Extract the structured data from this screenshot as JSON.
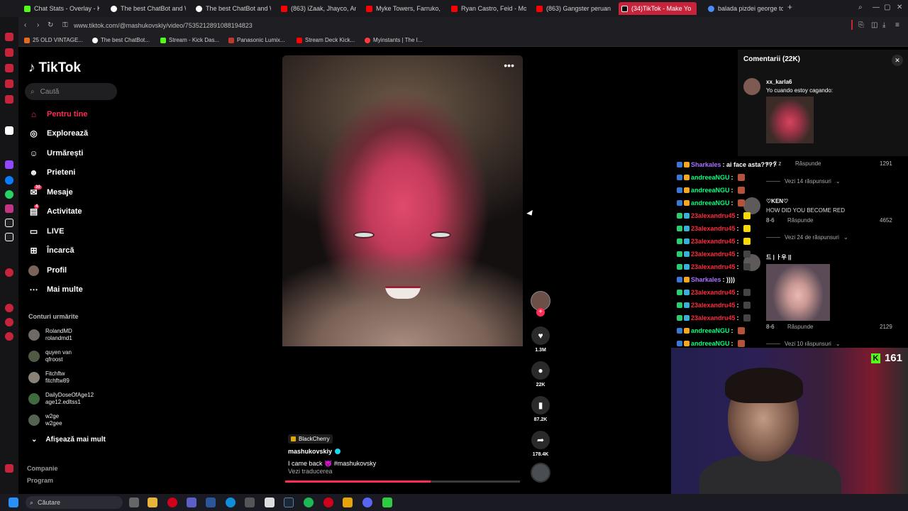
{
  "browser": {
    "tabs": [
      {
        "label": "Chat Stats - Overlay - Kic",
        "color": "#53fc18"
      },
      {
        "label": "The best ChatBot and Wi",
        "color": "#ffffff"
      },
      {
        "label": "The best ChatBot and Wi",
        "color": "#ffffff"
      },
      {
        "label": "(863) iZaak, Jhayco, Anu",
        "color": "#ff0000"
      },
      {
        "label": "Myke Towers, Farruko, A",
        "color": "#ff0000"
      },
      {
        "label": "Ryan Castro, Feid - Mona",
        "color": "#ff0000"
      },
      {
        "label": "(863) Gangster peruan şi",
        "color": "#ff0000"
      },
      {
        "label": "(34)TikTok - Make Yo",
        "color": "#ffffff"
      },
      {
        "label": "balada pizdei george topi",
        "color": "#4a8df8"
      }
    ],
    "new_tab": "+",
    "url": "www.tiktok.com/@mashukovskiy/video/7535212891088194823",
    "bookmarks": [
      {
        "label": "25 OLD VINTAGE...",
        "color": "#e36b1b"
      },
      {
        "label": "The best ChatBot...",
        "color": "#ffffff"
      },
      {
        "label": "Stream - Kick Das...",
        "color": "#53fc18"
      },
      {
        "label": "Panasonic Lumix...",
        "color": "#c0392b"
      },
      {
        "label": "Stream Deck Kick...",
        "color": "#ff0000"
      },
      {
        "label": "Myinstants | The I...",
        "color": "#ff3b3b"
      }
    ]
  },
  "tiktok": {
    "logo": "TikTok",
    "search_placeholder": "Caută",
    "nav": [
      {
        "label": "Pentru tine",
        "icon": "home-icon",
        "glyph": "⌂"
      },
      {
        "label": "Explorează",
        "icon": "compass-icon",
        "glyph": "◎"
      },
      {
        "label": "Urmărești",
        "icon": "following-icon",
        "glyph": "☺"
      },
      {
        "label": "Prieteni",
        "icon": "friends-icon",
        "glyph": "☻"
      },
      {
        "label": "Mesaje",
        "icon": "messages-icon",
        "glyph": "✉",
        "badge": "30"
      },
      {
        "label": "Activitate",
        "icon": "activity-icon",
        "glyph": "▤",
        "badge": "4"
      },
      {
        "label": "LIVE",
        "icon": "live-icon",
        "glyph": "▭"
      },
      {
        "label": "Încarcă",
        "icon": "upload-icon",
        "glyph": "⊞"
      },
      {
        "label": "Profil",
        "icon": "profile-icon",
        "glyph": "●"
      },
      {
        "label": "Mai multe",
        "icon": "more-icon",
        "glyph": "⋯"
      }
    ],
    "following_title": "Conturi urmărite",
    "following": [
      {
        "name": "RolandMD",
        "handle": "rolandmd1"
      },
      {
        "name": "quyen van",
        "handle": "qfroost"
      },
      {
        "name": "Fitchftw",
        "handle": "fitchftw89"
      },
      {
        "name": "DailyDoseOfAge12",
        "handle": "age12.edltss1"
      },
      {
        "name": "w2ge",
        "handle": "w2gee"
      }
    ],
    "show_more": "Afișează mai mult",
    "footer": [
      "Companie",
      "Program"
    ]
  },
  "video": {
    "music": "BlackCherry",
    "author": "mashukovskiy",
    "caption": "I came back 👿 #mashukovsky",
    "translate": "Vezi traducerea",
    "progress": 0.62,
    "likes": "1.3M",
    "comments": "22K",
    "saves": "87.2K",
    "shares": "178.4K",
    "more": "•••"
  },
  "comments_panel": {
    "title": "Comentarii (22K)",
    "close": "✕",
    "first": {
      "user": "xx_karla6",
      "text": "Yo cuando estoy cagando:"
    }
  },
  "chat": {
    "rows": [
      {
        "user": "Sharkales",
        "msg": ": ai face asta????",
        "color": "#a970ff"
      },
      {
        "user": "andreeaNGU",
        "msg": ":",
        "color": "#00ff7f"
      },
      {
        "user": "andreeaNGU",
        "msg": ":",
        "color": "#00ff7f"
      },
      {
        "user": "andreeaNGU",
        "msg": ":",
        "color": "#00ff7f"
      },
      {
        "user": "23alexandru45",
        "msg": ":",
        "color": "#ff2a3a"
      },
      {
        "user": "23alexandru45",
        "msg": ":",
        "color": "#ff2a3a"
      },
      {
        "user": "23alexandru45",
        "msg": ":",
        "color": "#ff2a3a"
      },
      {
        "user": "23alexandru45",
        "msg": ":",
        "color": "#ff2a3a"
      },
      {
        "user": "23alexandru45",
        "msg": ":",
        "color": "#ff2a3a"
      },
      {
        "user": "Sharkales",
        "msg": ": ))))",
        "color": "#a970ff"
      },
      {
        "user": "23alexandru45",
        "msg": ":",
        "color": "#ff2a3a"
      },
      {
        "user": "23alexandru45",
        "msg": ":",
        "color": "#ff2a3a"
      },
      {
        "user": "23alexandru45",
        "msg": ":",
        "color": "#ff2a3a"
      },
      {
        "user": "andreeaNGU",
        "msg": ":",
        "color": "#00ff7f"
      },
      {
        "user": "andreeaNGU",
        "msg": ":",
        "color": "#00ff7f"
      }
    ],
    "replies": [
      {
        "meta": "cu 2 z",
        "reply": "Răspunde",
        "likes": "1291",
        "view": "Vezi 14 răspunsuri"
      },
      {
        "user": "♡KEN♡",
        "text": "HOW DID YOU BECOME RED",
        "meta": "8-6",
        "reply": "Răspunde",
        "likes": "4652",
        "view": "Vezi 24 de răspunsuri"
      },
      {
        "user": "드 | ㅏ우 ||",
        "meta": "8-6",
        "reply": "Răspunde",
        "likes": "2129",
        "view": "Vezi 10 răspunsuri"
      }
    ]
  },
  "webcam": {
    "viewers": "161"
  },
  "taskbar": {
    "search": "Căutare"
  }
}
